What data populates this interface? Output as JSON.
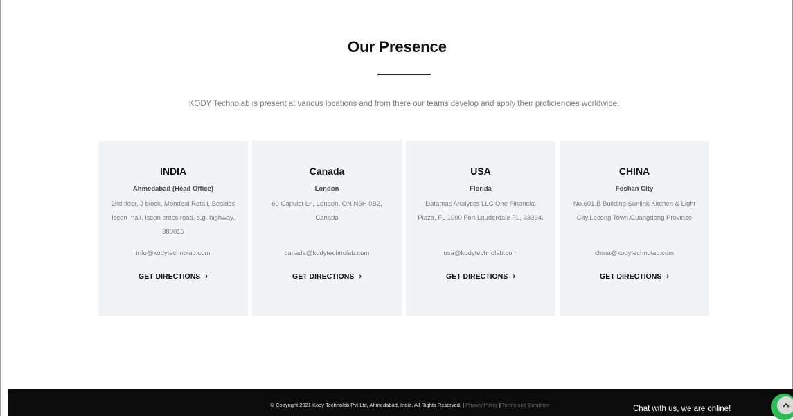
{
  "section": {
    "title": "Our Presence",
    "intro": "KODY Technolab is present at various locations and from there our teams develop and apply their proficiencies worldwide."
  },
  "locations": [
    {
      "country": "INDIA",
      "city": "Ahmedabad (Head Office)",
      "address": "2nd floor, J block, Mondeal Retail, Besides Iscon mall, Iscon cross road, s.g. highway, 380015",
      "email": "info@kodytechnolab.com",
      "directions": "GET DIRECTIONS"
    },
    {
      "country": "Canada",
      "city": "London",
      "address": "60 Capulet Ln, London, ON N6H 0B2, Canada",
      "email": "canada@kodytechnolab.com",
      "directions": "GET DIRECTIONS"
    },
    {
      "country": "USA",
      "city": "Florida",
      "address": "Datamac Analytics LLC One Financial Plaza, FL 1000 Fort Lauderdale FL, 33394.",
      "email": "usa@kodytechnolab.com",
      "directions": "GET DIRECTIONS"
    },
    {
      "country": "CHINA",
      "city": "Foshan City",
      "address": "No.601,B Building,Sunlink Kitchen & Light City,Lecong Town,Guangdong Province",
      "email": "china@kodytechnolab.com",
      "directions": "GET DIRECTIONS"
    }
  ],
  "footer": {
    "copyright": "© Copyright 2021 Kody Technolab Pvt Ltd, Ahmedabad, India. All Rights Reserved.",
    "separator": "|",
    "privacy_link": "Privacy Policy",
    "terms_link": "Terms and Condition",
    "chat_text": "Chat with us, we are online!"
  },
  "icons": {
    "directions_chevron": "chevron-right-icon",
    "chat": "chat-widget-icon",
    "scroll_top": "chevron-up-icon"
  },
  "colors": {
    "card_bg": "#f2f3f6",
    "footer_bg": "#0b0b0b",
    "chat_green": "#2fbb56"
  }
}
